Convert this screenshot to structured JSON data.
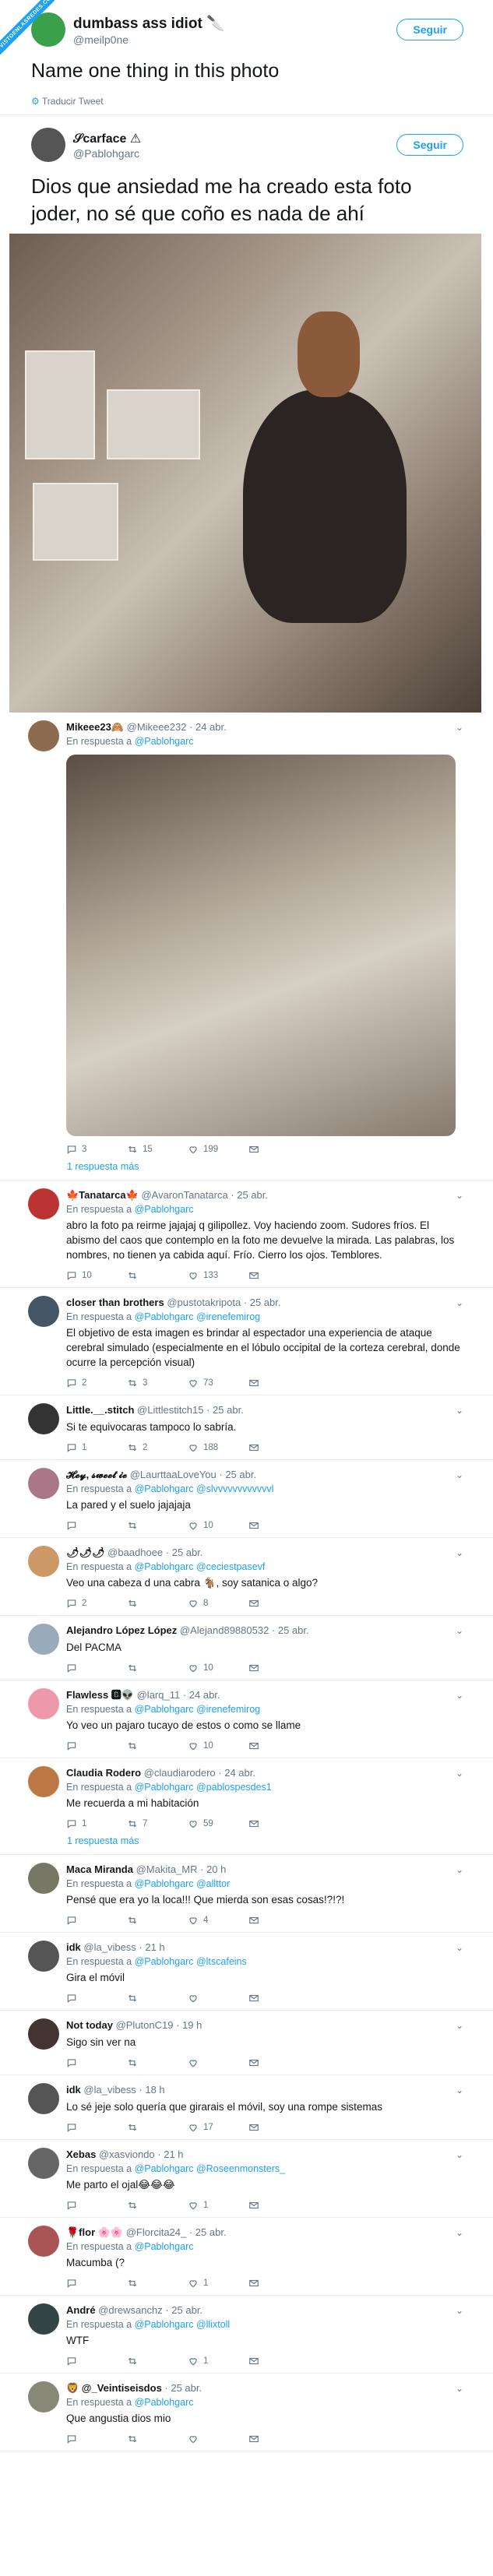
{
  "ribbon": "VISTOENLASREDES.COM",
  "quoted": {
    "name": "dumbass ass idiot",
    "emoji": "🔪",
    "handle": "@meilp0ne",
    "follow": "Seguir",
    "text": "Name one thing in this photo",
    "translate": "Traducir Tweet"
  },
  "main": {
    "name": "𝒮carface ⚠",
    "handle": "@Pablohgarc",
    "follow": "Seguir",
    "text": "Dios que ansiedad me ha creado esta foto joder, no sé que coño es nada de ahí"
  },
  "in_reply_label": "En respuesta a",
  "replies": [
    {
      "name": "Mikeee23🙈",
      "handle": "@Mikeee232 · 24 abr.",
      "to": "@Pablohgarc",
      "text": "",
      "has_photo": true,
      "stats": [
        "3",
        "15",
        "199"
      ],
      "thread": "1 respuesta más"
    },
    {
      "name": "🍁Tanatarca🍁",
      "handle": "@AvaronTanatarca · 25 abr.",
      "to": "@Pablohgarc",
      "text": "abro la foto pa reirme jajajaj q gilipollez. Voy haciendo zoom. Sudores fríos. El abismo del caos que contemplo en la foto me devuelve la mirada. Las palabras, los nombres, no tienen ya cabida aquí. Frío. Cierro los ojos. Temblores.",
      "stats": [
        "10",
        "",
        "133"
      ],
      "thread": ""
    },
    {
      "name": "closer than brothers",
      "handle": "@pustotakripota · 25 abr.",
      "to": "@Pablohgarc @irenefemirog",
      "text": "El objetivo de esta imagen es brindar al espectador una experiencia de ataque cerebral simulado (especialmente en el lóbulo occipital de la corteza cerebral, donde ocurre la percepción visual)",
      "stats": [
        "2",
        "3",
        "73"
      ],
      "thread": ""
    },
    {
      "name": "Little.__.stitch",
      "handle": "@Littlestitch15 · 25 abr.",
      "to": "",
      "text": "Si te equivocaras tampoco lo sabría.",
      "stats": [
        "1",
        "2",
        "188"
      ],
      "thread": ""
    },
    {
      "name": "𝓗𝓮𝔂, 𝓼𝔀𝓮𝓮𝓽 𝓲𝓮",
      "handle": "@LaurttaaLoveYou · 25 abr.",
      "to": "@Pablohgarc @slvvvvvvvvvvvvl",
      "text": "La pared y el suelo jajajaja",
      "stats": [
        "",
        "",
        "10"
      ],
      "thread": ""
    },
    {
      "name": "🌶🌶🌶",
      "handle": "@baadhoee · 25 abr.",
      "to": "@Pablohgarc @ceciestpasevf",
      "text": "Veo una cabeza d una cabra 🐐, soy satanica o algo?",
      "stats": [
        "2",
        "",
        "8"
      ],
      "thread": ""
    },
    {
      "name": "Alejandro López López",
      "handle": "@Alejand89880532 · 25 abr.",
      "to": "",
      "text": "Del PACMA",
      "stats": [
        "",
        "",
        "10"
      ],
      "thread": ""
    },
    {
      "name": "Flawless 🅱👽",
      "handle": "@larq_11 · 24 abr.",
      "to": "@Pablohgarc @irenefemirog",
      "text": "Yo veo un pajaro tucayo de estos o como se llame",
      "stats": [
        "",
        "",
        "10"
      ],
      "thread": ""
    },
    {
      "name": "Claudia Rodero",
      "handle": "@claudiarodero · 24 abr.",
      "to": "@Pablohgarc @pablospesdes1",
      "text": "Me recuerda a mi habitación",
      "stats": [
        "1",
        "7",
        "59"
      ],
      "thread": "1 respuesta más"
    },
    {
      "name": "Maca Miranda",
      "handle": "@Makita_MR · 20 h",
      "to": "@Pablohgarc @allttor",
      "text": "Pensé que era yo la loca!!! Que mierda son esas cosas!?!?!",
      "stats": [
        "",
        "",
        "4"
      ],
      "thread": ""
    },
    {
      "name": "idk",
      "handle": "@la_vibess · 21 h",
      "to": "@Pablohgarc @ltscafeins",
      "text": "Gira el móvil",
      "stats": [
        "",
        "",
        ""
      ],
      "thread": ""
    },
    {
      "name": "Not today",
      "handle": "@PlutonC19 · 19 h",
      "to": "",
      "text": "Sigo sin ver na",
      "stats": [
        "",
        "",
        ""
      ],
      "thread": ""
    },
    {
      "name": "idk",
      "handle": "@la_vibess · 18 h",
      "to": "",
      "text": "Lo sé jeje solo quería que girarais el móvil, soy una rompe sistemas",
      "stats": [
        "",
        "",
        "17"
      ],
      "thread": ""
    },
    {
      "name": "Xebas",
      "handle": "@xasviondo · 21 h",
      "to": "@Pablohgarc @Roseenmonsters_",
      "text": "Me parto el ojal😂😂😂",
      "stats": [
        "",
        "",
        "1"
      ],
      "thread": ""
    },
    {
      "name": "🌹flor 🌸🌸",
      "handle": "@Florcita24_ · 25 abr.",
      "to": "@Pablohgarc",
      "text": "Macumba (?",
      "stats": [
        "",
        "",
        "1"
      ],
      "thread": ""
    },
    {
      "name": "André",
      "handle": "@drewsanchz · 25 abr.",
      "to": "@Pablohgarc @llixtoll",
      "text": "WTF",
      "stats": [
        "",
        "",
        "1"
      ],
      "thread": ""
    },
    {
      "name": "🦁 @_Veintiseisdos",
      "handle": "· 25 abr.",
      "to": "@Pablohgarc",
      "text": "Que angustia dios mio",
      "stats": [
        "",
        "",
        ""
      ],
      "thread": ""
    }
  ]
}
